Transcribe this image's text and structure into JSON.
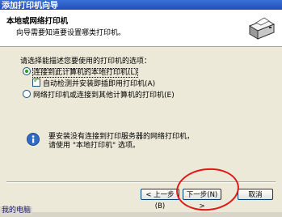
{
  "window": {
    "title": "添加打印机向导"
  },
  "header": {
    "title": "本地或网络打印机",
    "subtitle": "向导需要知道要设置哪类打印机。"
  },
  "prompt": "请选择能描述您要使用的打印机的选项：",
  "options": {
    "local_label": "连接到此计算机的本地打印机(L)",
    "autodetect_label": "自动检测并安装即插即用打印机(A)",
    "network_label": "网络打印机或连接到其他计算机的打印机(E)"
  },
  "info": {
    "line1": "要安装没有连接到打印服务器的网络打印机，",
    "line2": "请使用 \"本地打印机\" 选项。"
  },
  "buttons": {
    "back": "< 上一步(B)",
    "next": "下一步(N) >",
    "cancel": "取消"
  },
  "taskbar": {
    "text": "我的电脑"
  },
  "colors": {
    "annotation_circle": "#e01818",
    "title_bar": "#1f4fb8"
  }
}
